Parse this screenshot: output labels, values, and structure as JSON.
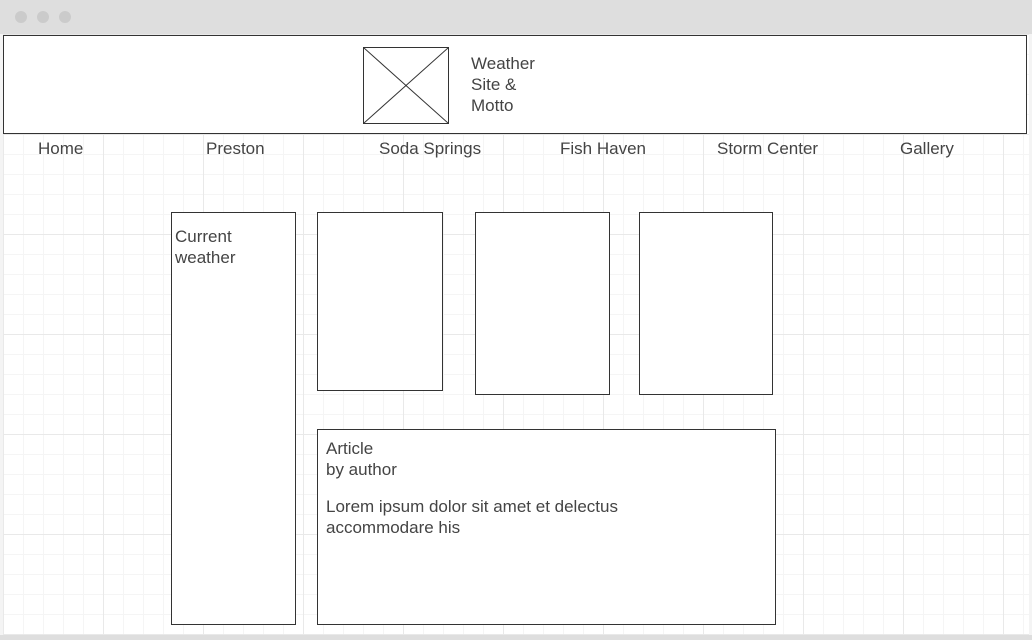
{
  "header": {
    "site_title": "Weather\nSite &\nMotto",
    "logo_icon": "image-placeholder-icon"
  },
  "nav": {
    "items": [
      {
        "label": "Home"
      },
      {
        "label": "Preston"
      },
      {
        "label": "Soda Springs"
      },
      {
        "label": "Fish Haven"
      },
      {
        "label": "Storm Center"
      },
      {
        "label": "Gallery"
      }
    ]
  },
  "sidebar": {
    "label": "Current\nweather"
  },
  "article": {
    "title": "Article",
    "byline": "by author",
    "body": "Lorem ipsum dolor sit amet et delectus\naccommodare his"
  },
  "colors": {
    "line": "#333333",
    "text": "#444444",
    "titlebar": "#dedede"
  }
}
